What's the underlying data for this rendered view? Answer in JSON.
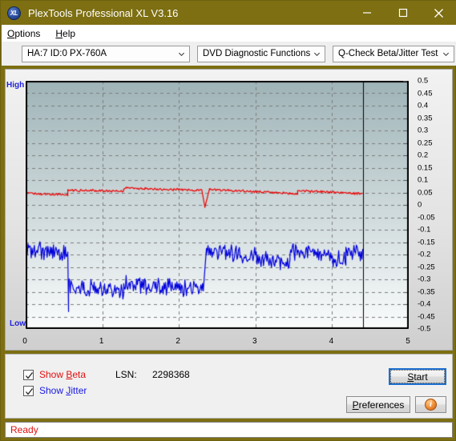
{
  "window": {
    "title": "PlexTools Professional XL V3.16",
    "logo_text": "XL",
    "minimize_icon": "minimize-icon",
    "maximize_icon": "maximize-icon",
    "close_icon": "close-icon",
    "titlebar_color": "#7d6f12"
  },
  "menu": {
    "items": [
      {
        "label": "Options",
        "accel": "O"
      },
      {
        "label": "Help",
        "accel": "H"
      }
    ]
  },
  "toolbar": {
    "drive_select": "HA:7 ID:0  PX-760A",
    "function_select": "DVD Diagnostic Functions",
    "test_select": "Q-Check Beta/Jitter Test",
    "caret_icon": "chevron-down-icon"
  },
  "chart_labels": {
    "high": "High",
    "low": "Low"
  },
  "controls": {
    "show_beta": {
      "label": "Show Beta",
      "accel": "B",
      "checked": true,
      "color": "#e01010"
    },
    "show_jitter": {
      "label": "Show Jitter",
      "accel": "J",
      "checked": true,
      "color": "#1818e0"
    },
    "lsn_label": "LSN:",
    "lsn_value": "2298368",
    "start_button": {
      "label": "Start",
      "accel": "S"
    },
    "preferences_button": {
      "label": "Preferences",
      "accel": "P"
    },
    "info_button": {
      "icon": "info-icon",
      "glyph": "i"
    }
  },
  "status": {
    "text": "Ready"
  },
  "chart_data": {
    "type": "line",
    "title": "Q-Check Beta/Jitter Test",
    "xlabel": "",
    "ylabel": "",
    "xlim": [
      0,
      5
    ],
    "ylim": [
      -0.5,
      0.5
    ],
    "xticks": [
      0,
      1,
      2,
      3,
      4,
      5
    ],
    "yticks": [
      0.5,
      0.45,
      0.4,
      0.35,
      0.3,
      0.25,
      0.2,
      0.15,
      0.1,
      0.05,
      0,
      -0.05,
      -0.1,
      -0.15,
      -0.2,
      -0.25,
      -0.3,
      -0.35,
      -0.4,
      -0.45,
      -0.5
    ],
    "ytick_labels": [
      "0.5",
      "0.45",
      "0.4",
      "0.35",
      "0.3",
      "0.25",
      "0.2",
      "0.15",
      "0.1",
      "0.05",
      "0",
      "-0.05",
      "-0.1",
      "-0.15",
      "-0.2",
      "-0.25",
      "-0.3",
      "-0.35",
      "-0.4",
      "-0.45",
      "-0.5"
    ],
    "grid": true,
    "grid_style": "dashed",
    "grid_color": "#7d7d7d",
    "background_gradient": [
      "#9fb4b8",
      "#fafcfc"
    ],
    "cursor_line_x": 4.4,
    "cursor_line_color": "#000000",
    "data_end_x": 4.4,
    "legend": [
      "Beta",
      "Jitter"
    ],
    "series": [
      {
        "name": "Beta",
        "color": "#ee0000",
        "noise": 0.004,
        "segments": [
          {
            "x0": 0.0,
            "x1": 0.55,
            "y0": 0.048,
            "y1": 0.04
          },
          {
            "x0": 0.55,
            "x1": 1.28,
            "y0": 0.059,
            "y1": 0.056
          },
          {
            "x0": 1.28,
            "x1": 2.3,
            "y0": 0.068,
            "y1": 0.059
          },
          {
            "x0": 2.3,
            "x1": 2.34,
            "y0": 0.059,
            "y1": -0.01
          },
          {
            "x0": 2.34,
            "x1": 2.4,
            "y0": -0.01,
            "y1": 0.063
          },
          {
            "x0": 2.4,
            "x1": 3.55,
            "y0": 0.063,
            "y1": 0.044
          },
          {
            "x0": 3.55,
            "x1": 4.4,
            "y0": 0.058,
            "y1": 0.045
          }
        ]
      },
      {
        "name": "Jitter",
        "color": "#0000dd",
        "noise": 0.028,
        "segments": [
          {
            "x0": 0.0,
            "x1": 0.55,
            "y0": -0.185,
            "y1": -0.19
          },
          {
            "x0": 0.55,
            "x1": 0.56,
            "y0": -0.19,
            "y1": -0.43
          },
          {
            "x0": 0.56,
            "x1": 1.28,
            "y0": -0.33,
            "y1": -0.345
          },
          {
            "x0": 1.28,
            "x1": 2.32,
            "y0": -0.318,
            "y1": -0.34
          },
          {
            "x0": 2.32,
            "x1": 2.36,
            "y0": -0.34,
            "y1": -0.175
          },
          {
            "x0": 2.36,
            "x1": 3.45,
            "y0": -0.175,
            "y1": -0.235
          },
          {
            "x0": 3.45,
            "x1": 4.18,
            "y0": -0.182,
            "y1": -0.225
          },
          {
            "x0": 4.18,
            "x1": 4.4,
            "y0": -0.183,
            "y1": -0.205
          }
        ]
      }
    ]
  }
}
